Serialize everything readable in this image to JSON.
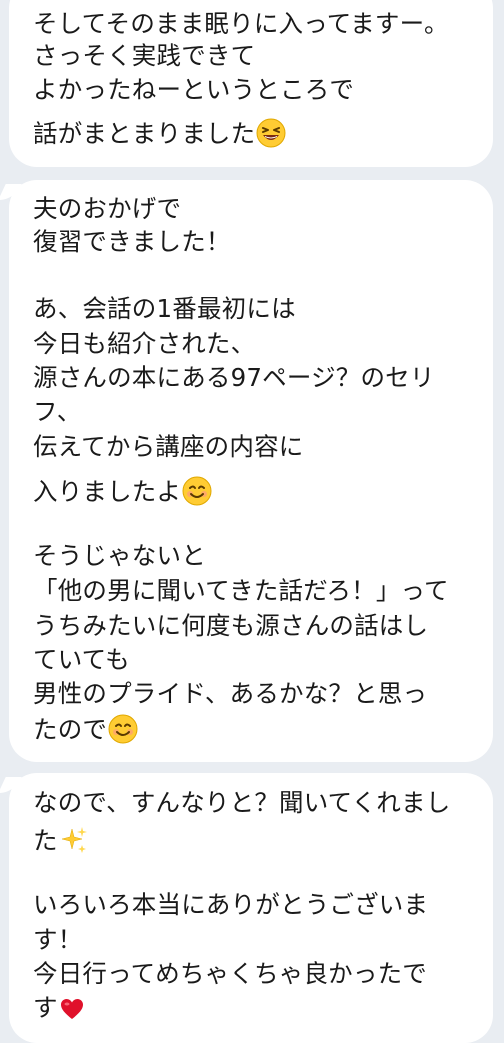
{
  "messages": [
    {
      "lines": [
        "そしてそのまま眠りに入ってますー。",
        "さっそく実践できて",
        "よかったねーというところで",
        "話がまとまりました"
      ],
      "trailing_emoji": "laughing-squint-face-emoji"
    },
    {
      "lines": [
        "夫のおかげで",
        "復習できました！",
        "あ、会話の1番最初には",
        "今日も紹介された、",
        "源さんの本にある97ページ？のセリ",
        "フ、",
        "伝えてから講座の内容に",
        "入りましたよ",
        "そうじゃないと",
        "「他の男に聞いてきた話だろ！」って",
        "うちみたいに何度も源さんの話はし",
        "ていても",
        "男性のプライド、あるかな？と思っ",
        "たので"
      ],
      "emojis": [
        "smiling-face-emoji",
        "smiling-face-emoji"
      ]
    },
    {
      "lines": [
        "なので、すんなりと？聞いてくれまし",
        "た",
        "いろいろ本当にありがとうございま",
        "す！",
        "今日行ってめちゃくちゃ良かったで",
        "す"
      ],
      "emojis": [
        "sparkles-emoji",
        "red-heart-emoji"
      ]
    }
  ],
  "colors": {
    "background": "#e9edf2",
    "bubble": "#ffffff",
    "text": "#1a1a1a"
  }
}
